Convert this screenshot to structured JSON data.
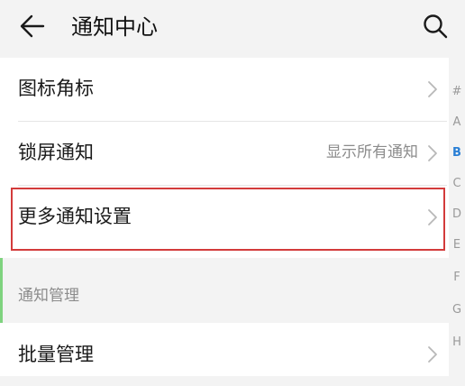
{
  "header": {
    "title": "通知中心"
  },
  "settings": {
    "rows": [
      {
        "label": "图标角标",
        "value": ""
      },
      {
        "label": "锁屏通知",
        "value": "显示所有通知"
      },
      {
        "label": "更多通知设置",
        "value": ""
      }
    ]
  },
  "section": {
    "title": "通知管理",
    "rows": [
      {
        "label": "批量管理"
      }
    ]
  },
  "index_bar": {
    "letters": [
      "#",
      "A",
      "B",
      "C",
      "D",
      "E",
      "F",
      "G",
      "H"
    ],
    "active": "B"
  },
  "colors": {
    "background": "#f3f3f3",
    "card": "#ffffff",
    "highlight_border": "#d33b3b",
    "index_active": "#2a7fd5"
  }
}
